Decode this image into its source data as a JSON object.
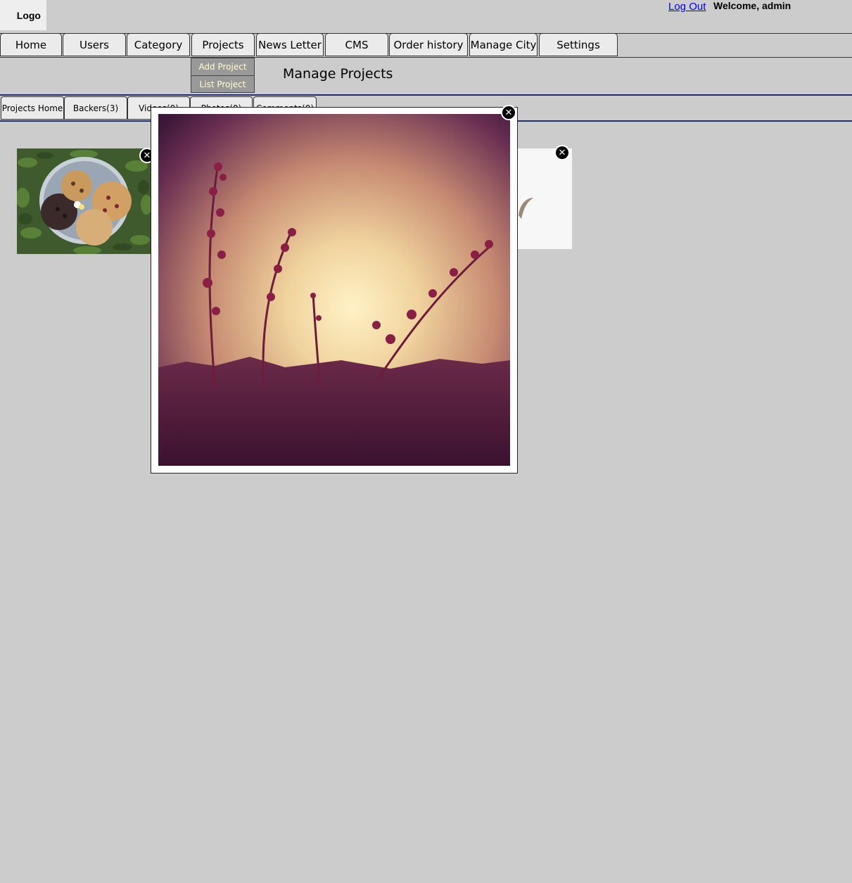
{
  "header": {
    "logo": "Logo",
    "logout": "Log Out",
    "welcome": "Welcome, admin"
  },
  "nav": {
    "items": [
      "Home",
      "Users",
      "Category",
      "Projects",
      "News Letter",
      "CMS",
      "Order history",
      "Manage City",
      "Settings"
    ],
    "dropdown": [
      "Add Project",
      "List Project"
    ]
  },
  "page": {
    "title": "Manage Projects"
  },
  "subtabs": [
    "Projects Home",
    "Backers(3)",
    "Videos(0)",
    "Photos(0)",
    "Comments(0)"
  ],
  "icons": {
    "close": "close-icon"
  },
  "colors": {
    "accent_line": "#1b2f6b",
    "dropdown_text": "#ffffcc",
    "background": "#cccccc"
  }
}
